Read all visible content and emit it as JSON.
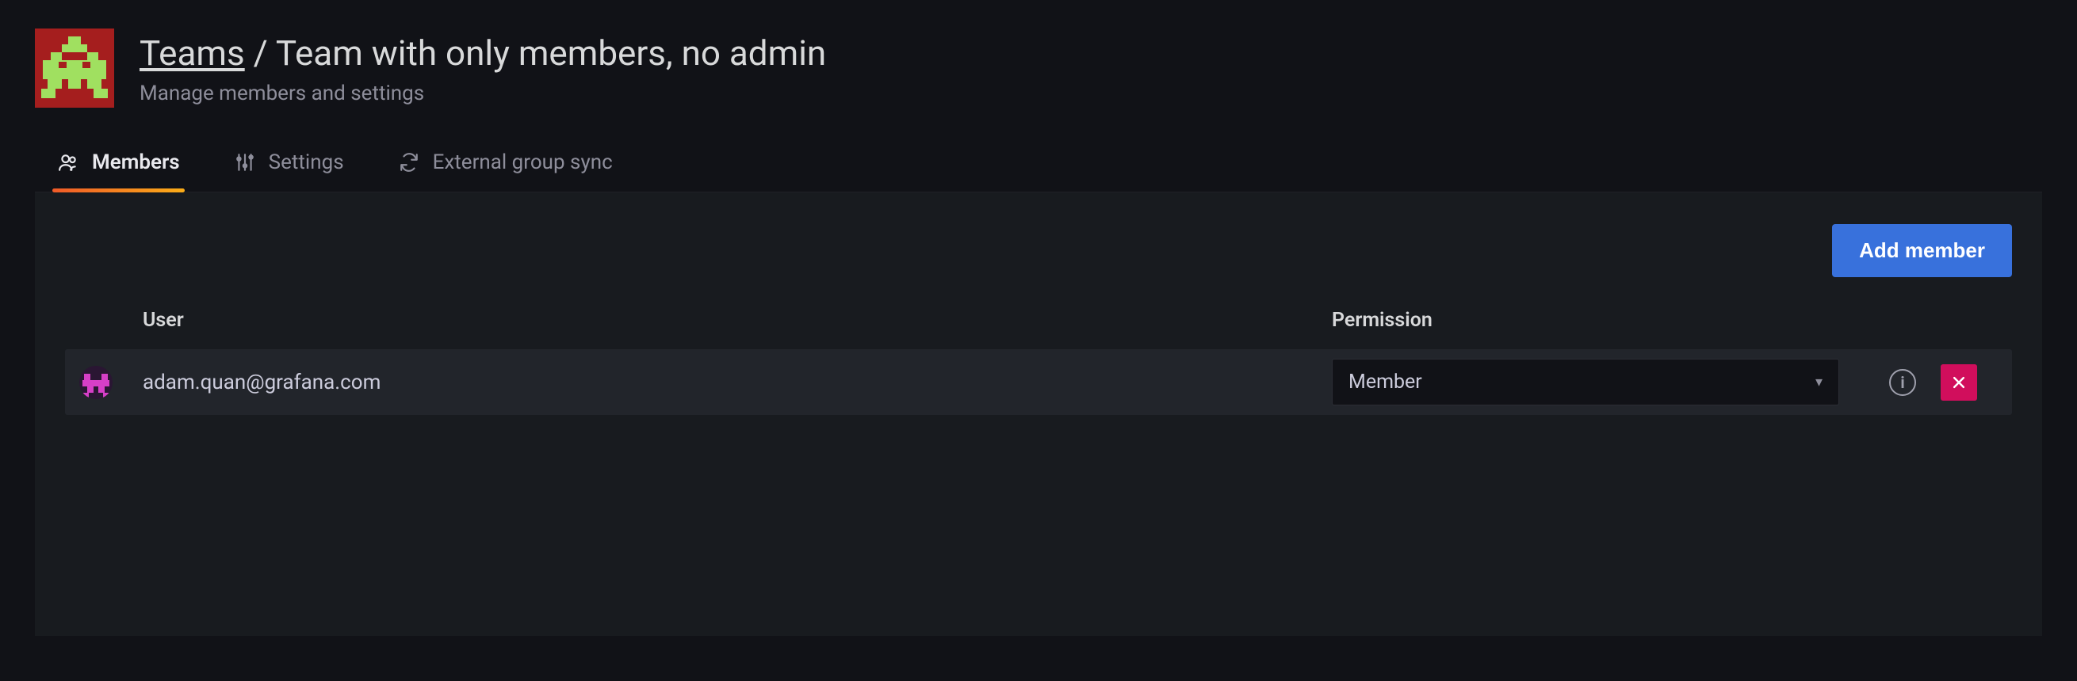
{
  "header": {
    "breadcrumb_root": "Teams",
    "breadcrumb_separator": " / ",
    "team_name": "Team with only members, no admin",
    "subtitle": "Manage members and settings"
  },
  "tabs": [
    {
      "label": "Members",
      "active": true
    },
    {
      "label": "Settings",
      "active": false
    },
    {
      "label": "External group sync",
      "active": false
    }
  ],
  "actions": {
    "add_member_label": "Add member"
  },
  "table": {
    "columns": {
      "user": "User",
      "permission": "Permission"
    },
    "rows": [
      {
        "email": "adam.quan@grafana.com",
        "permission": "Member"
      }
    ]
  }
}
